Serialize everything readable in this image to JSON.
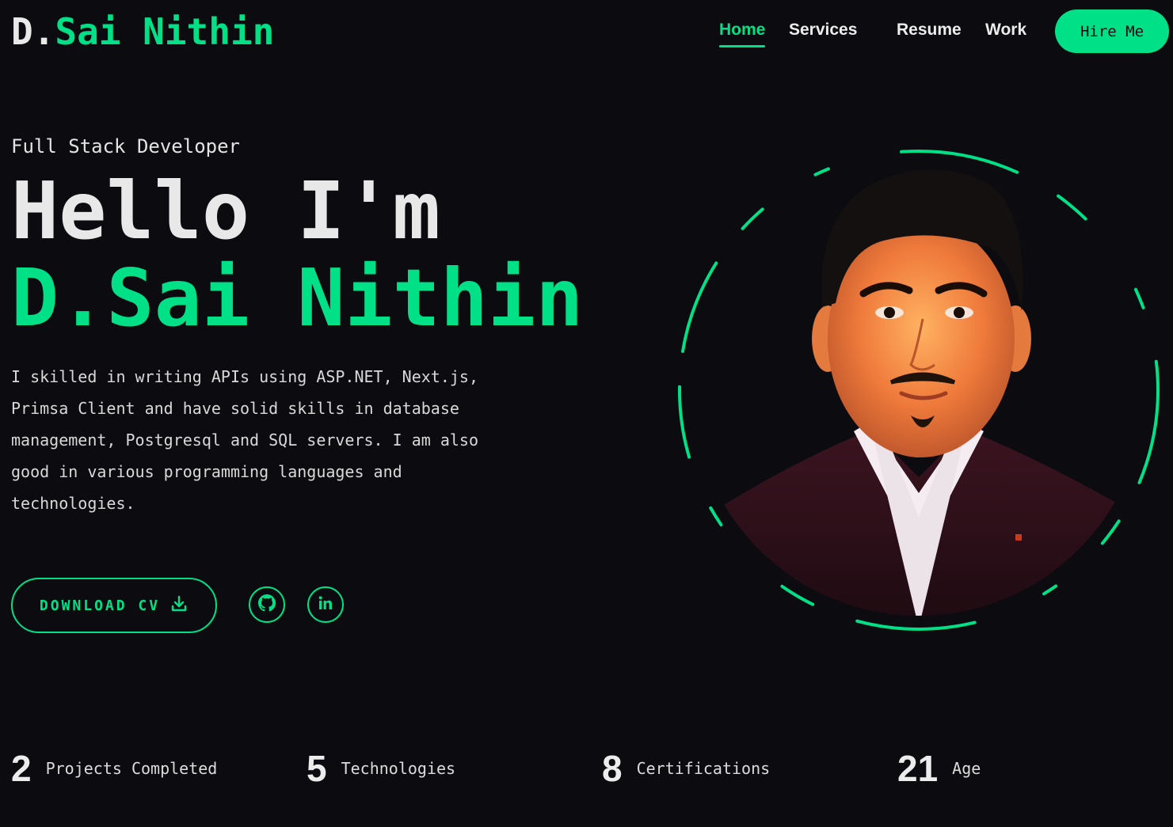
{
  "brand": {
    "prefix": "D.",
    "name": "Sai Nithin"
  },
  "nav": {
    "items": [
      {
        "label": "Home",
        "active": true
      },
      {
        "label": "Services",
        "active": false
      },
      {
        "label": "Resume",
        "active": false
      },
      {
        "label": "Work",
        "active": false
      }
    ],
    "cta_label": "Hire Me"
  },
  "hero": {
    "role": "Full Stack Developer",
    "greeting": "Hello I'm",
    "name": "D.Sai Nithin",
    "bio": "I skilled in writing APIs using ASP.NET, Next.js, Primsa Client and have solid skills in database management, Postgresql and SQL servers. I am also good in various programming languages and technologies.",
    "download_label": "DOWNLOAD CV",
    "download_icon": "download-icon",
    "socials": [
      {
        "icon": "github-icon"
      },
      {
        "icon": "linkedin-icon"
      }
    ]
  },
  "stats": [
    {
      "value": "2",
      "label": "Projects Completed"
    },
    {
      "value": "5",
      "label": "Technologies"
    },
    {
      "value": "8",
      "label": "Certifications"
    },
    {
      "value": "21",
      "label": "Age"
    }
  ],
  "colors": {
    "background": "#0c0c10",
    "accent": "#00e187",
    "text": "#ececec"
  }
}
